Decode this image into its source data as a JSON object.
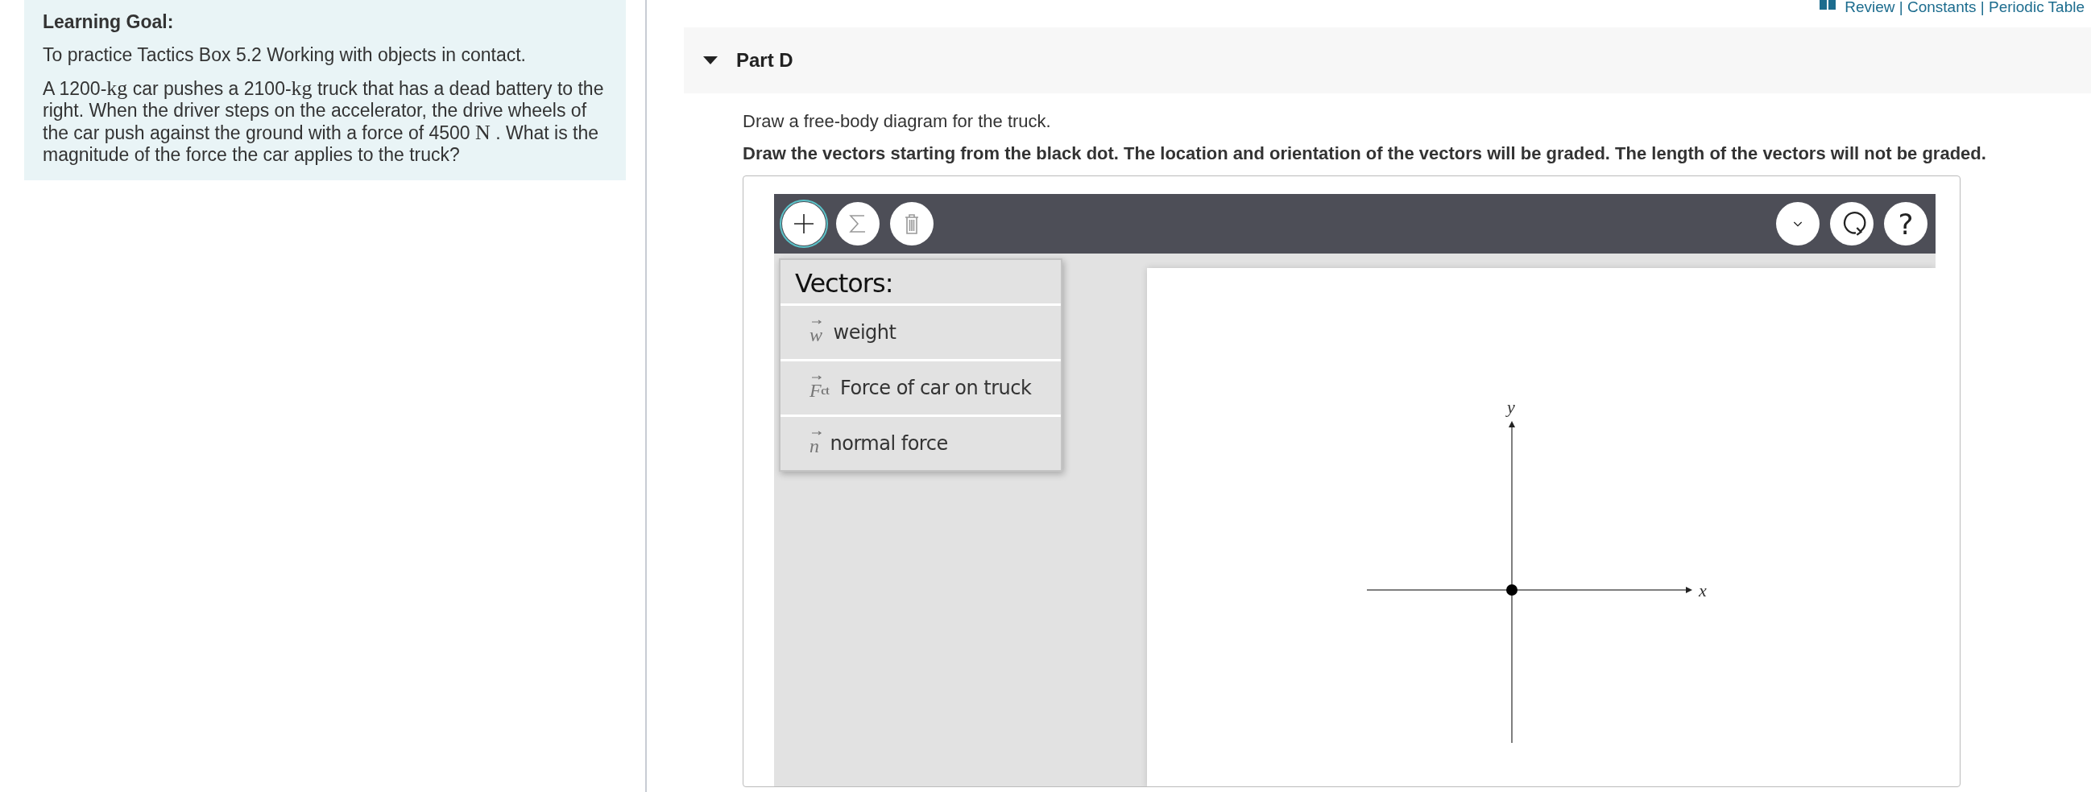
{
  "header_links": "Review | Constants | Periodic Table",
  "learning_goal": {
    "title": "Learning Goal:",
    "paragraphs": [
      [
        {
          "kind": "text",
          "text": "To practice Tactics Box 5.2 Working with objects in contact."
        }
      ],
      [
        {
          "kind": "text",
          "text": "A 1200-"
        },
        {
          "kind": "math",
          "text": "kg"
        },
        {
          "kind": "text",
          "text": " car pushes a 2100-"
        },
        {
          "kind": "math",
          "text": "kg"
        },
        {
          "kind": "text",
          "text": " truck that has a dead battery to the right. When the driver steps on the accelerator, the drive wheels of the car push against the ground with a force of 4500 "
        },
        {
          "kind": "math",
          "text": "N"
        },
        {
          "kind": "text",
          "text": " . What is the magnitude of the force the car applies to the truck?"
        }
      ]
    ]
  },
  "part": {
    "title": "Part D",
    "expanded": true,
    "instruction": "Draw a free-body diagram for the truck.",
    "note": "Draw the vectors starting from the black dot. The location and orientation of the vectors will be graded. The length of the vectors will not be graded."
  },
  "toolbar": {
    "left": [
      {
        "kind": "add",
        "selected": true
      },
      {
        "kind": "sum",
        "selected": false
      },
      {
        "kind": "delete",
        "selected": false
      }
    ],
    "right": [
      {
        "kind": "collapse"
      },
      {
        "kind": "reset"
      },
      {
        "kind": "help",
        "label": "?"
      }
    ]
  },
  "vector_menu": {
    "title": "Vectors:",
    "items": [
      {
        "symbol": "w",
        "label": "weight"
      },
      {
        "symbol": "F",
        "subscript": "ct",
        "label": "Force of car on truck"
      },
      {
        "symbol": "n",
        "label": "normal force"
      }
    ]
  },
  "axes": {
    "x_label": "x",
    "y_label": "y"
  }
}
